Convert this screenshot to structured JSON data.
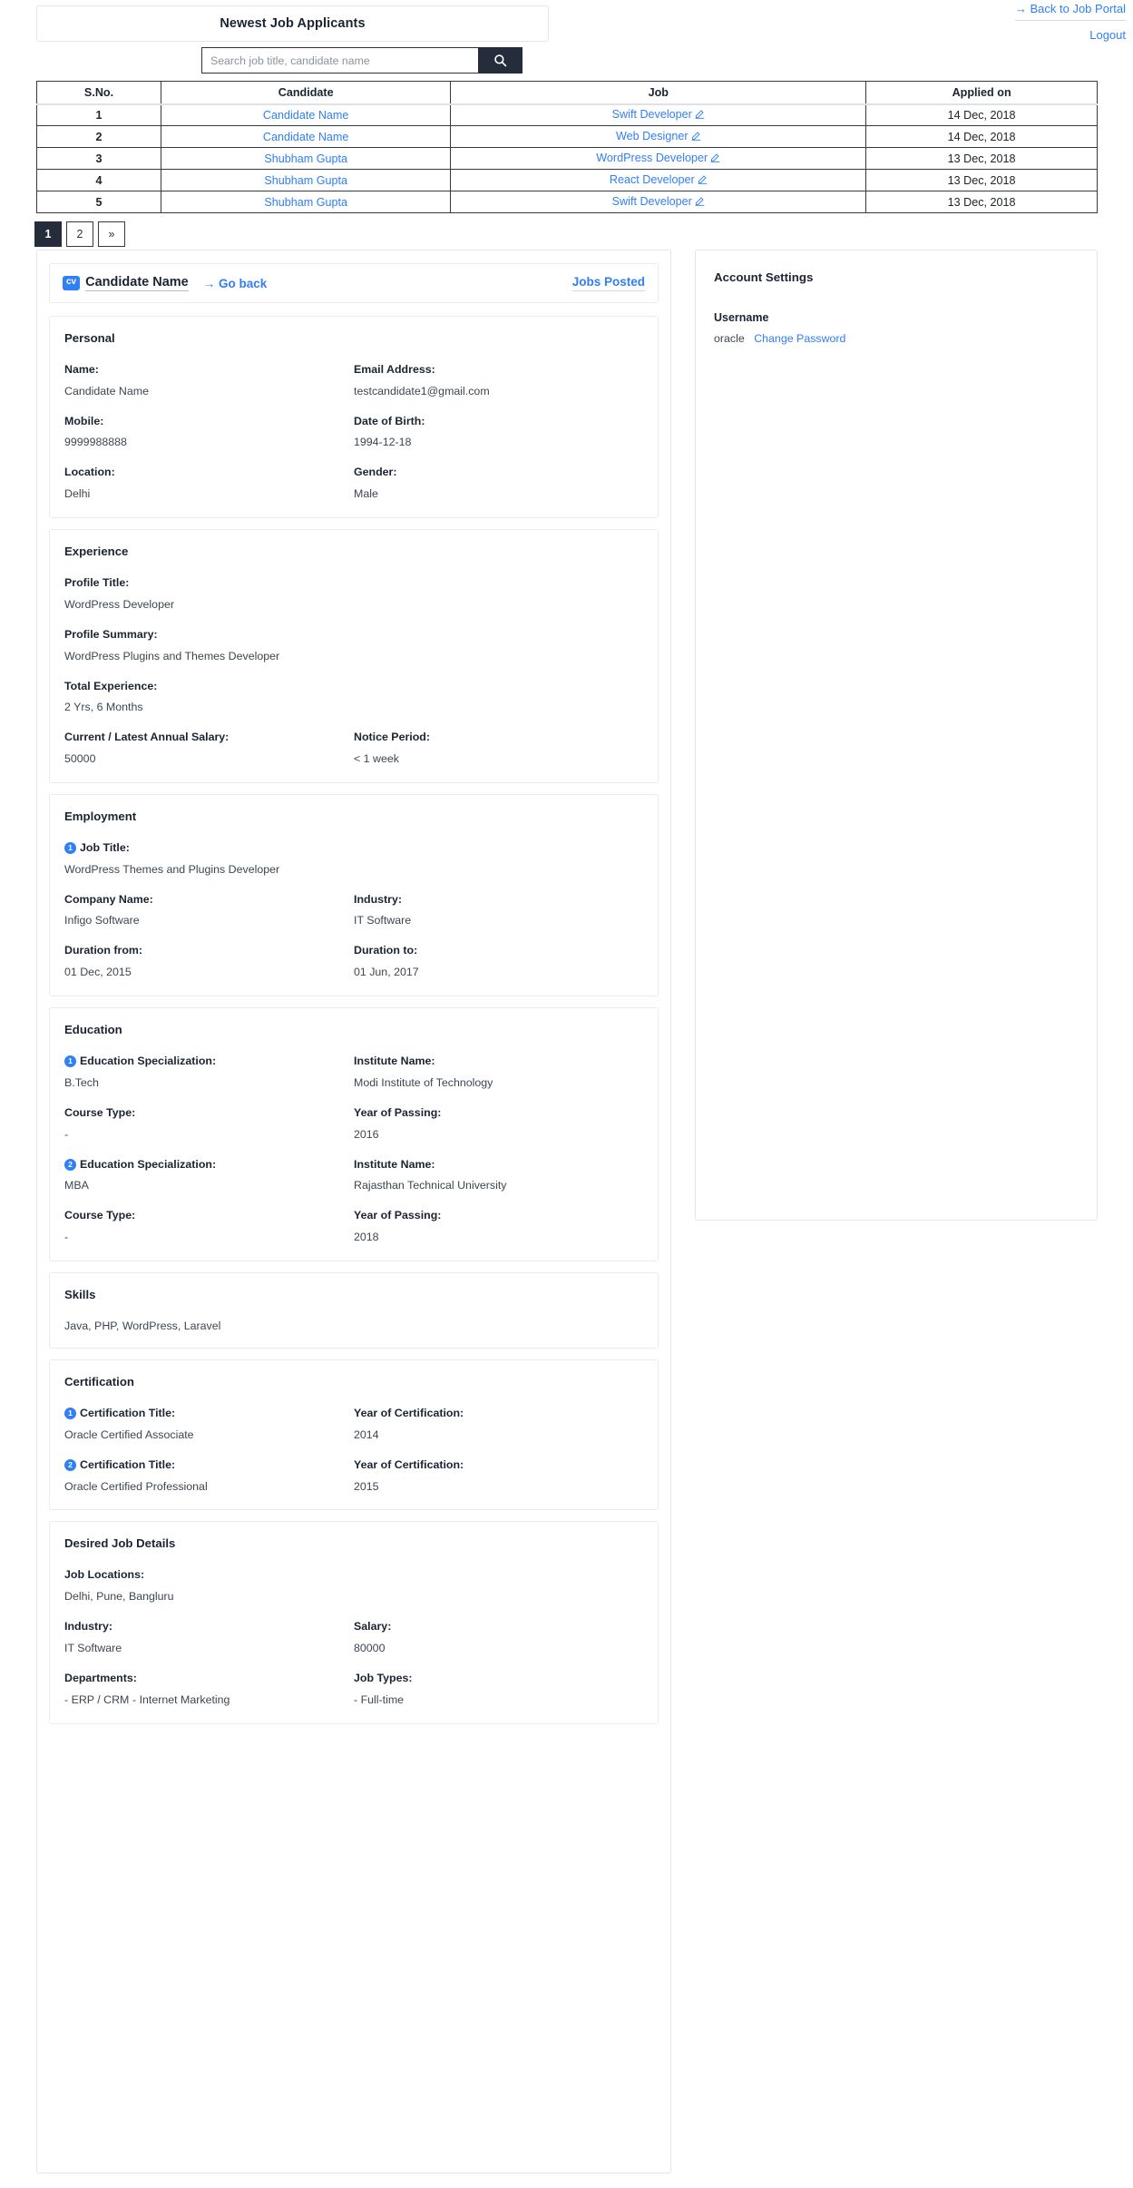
{
  "header": {
    "page_title": "Newest Job Applicants",
    "back_link": "→ Back to Job Portal",
    "logout_link": "Logout"
  },
  "search": {
    "placeholder": "Search job title, candidate name",
    "value": "",
    "icon": "search-icon"
  },
  "applicants_table": {
    "columns": [
      "S.No.",
      "Candidate",
      "Job",
      "Applied on"
    ],
    "rows": [
      {
        "sno": "1",
        "candidate": "Candidate Name",
        "job": "Swift Developer",
        "applied_on": "14 Dec, 2018"
      },
      {
        "sno": "2",
        "candidate": "Candidate Name",
        "job": "Web Designer",
        "applied_on": "14 Dec, 2018"
      },
      {
        "sno": "3",
        "candidate": "Shubham Gupta",
        "job": "WordPress Developer",
        "applied_on": "13 Dec, 2018"
      },
      {
        "sno": "4",
        "candidate": "Shubham Gupta",
        "job": "React Developer",
        "applied_on": "13 Dec, 2018"
      },
      {
        "sno": "5",
        "candidate": "Shubham Gupta",
        "job": "Swift Developer",
        "applied_on": "13 Dec, 2018"
      }
    ]
  },
  "pagination": {
    "pages": [
      "1",
      "2",
      "»"
    ],
    "active": "1"
  },
  "profile": {
    "badge": "cv",
    "name": "Candidate Name",
    "go_back": "→ Go back",
    "jobs_posted": "Jobs Posted",
    "personal": {
      "title": "Personal",
      "name_label": "Name:",
      "name_value": "Candidate Name",
      "email_label": "Email Address:",
      "email_value": "testcandidate1@gmail.com",
      "mobile_label": "Mobile:",
      "mobile_value": "9999988888",
      "dob_label": "Date of Birth:",
      "dob_value": "1994-12-18",
      "location_label": "Location:",
      "location_value": "Delhi",
      "gender_label": "Gender:",
      "gender_value": "Male"
    },
    "experience": {
      "title": "Experience",
      "profile_title_label": "Profile Title:",
      "profile_title_value": "WordPress Developer",
      "profile_summary_label": "Profile Summary:",
      "profile_summary_value": "WordPress Plugins and Themes Developer",
      "total_experience_label": "Total Experience:",
      "total_experience_value": "2 Yrs, 6 Months",
      "salary_label": "Current / Latest Annual Salary:",
      "salary_value": "50000",
      "notice_label": "Notice Period:",
      "notice_value": "< 1 week"
    },
    "employment": {
      "title": "Employment",
      "index": "1",
      "job_title_label": "Job Title:",
      "job_title_value": "WordPress Themes and Plugins Developer",
      "company_label": "Company Name:",
      "company_value": "Infigo Software",
      "industry_label": "Industry:",
      "industry_value": "IT Software",
      "from_label": "Duration from:",
      "from_value": "01 Dec, 2015",
      "to_label": "Duration to:",
      "to_value": "01 Jun, 2017"
    },
    "education": {
      "title": "Education",
      "entries": [
        {
          "index": "1",
          "spec_label": "Education Specialization:",
          "spec_value": "B.Tech",
          "institute_label": "Institute Name:",
          "institute_value": "Modi Institute of Technology",
          "course_label": "Course Type:",
          "course_value": "-",
          "year_label": "Year of Passing:",
          "year_value": "2016"
        },
        {
          "index": "2",
          "spec_label": "Education Specialization:",
          "spec_value": "MBA",
          "institute_label": "Institute Name:",
          "institute_value": "Rajasthan Technical University",
          "course_label": "Course Type:",
          "course_value": "-",
          "year_label": "Year of Passing:",
          "year_value": "2018"
        }
      ]
    },
    "skills": {
      "title": "Skills",
      "value": "Java, PHP, WordPress, Laravel"
    },
    "certification": {
      "title": "Certification",
      "entries": [
        {
          "index": "1",
          "title_label": "Certification Title:",
          "title_value": "Oracle Certified Associate",
          "year_label": "Year of Certification:",
          "year_value": "2014"
        },
        {
          "index": "2",
          "title_label": "Certification Title:",
          "title_value": "Oracle Certified Professional",
          "year_label": "Year of Certification:",
          "year_value": "2015"
        }
      ]
    },
    "desired_job": {
      "title": "Desired Job Details",
      "locations_label": "Job Locations:",
      "locations_value": "Delhi, Pune, Bangluru",
      "industry_label": "Industry:",
      "industry_value": "IT Software",
      "salary_label": "Salary:",
      "salary_value": "80000",
      "departments_label": "Departments:",
      "departments_value_1": "- ERP / CRM",
      "departments_value_2": "- Internet Marketing",
      "job_types_label": "Job Types:",
      "job_types_value": "- Full-time"
    }
  },
  "account_settings": {
    "title": "Account Settings",
    "username_label": "Username",
    "username_value": "oracle",
    "change_password_link": "Change Password"
  },
  "colors": {
    "link": "#2f7ff5",
    "dark": "#252c3b",
    "border": "#343a40",
    "text": "#212529"
  }
}
